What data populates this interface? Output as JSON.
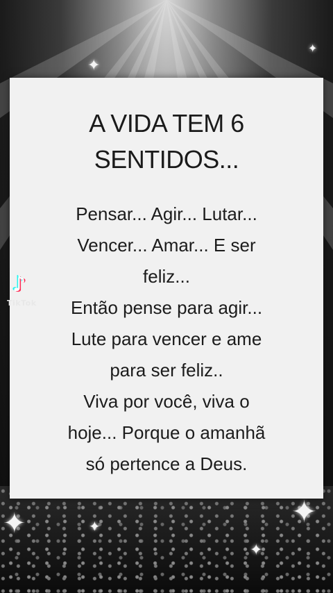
{
  "post": {
    "title_lines": [
      "A VIDA TEM 6",
      "SENTIDOS..."
    ],
    "body_lines": [
      "Pensar... Agir... Lutar...",
      "Vencer... Amar... E ser",
      "feliz...",
      "Então pense para agir...",
      "Lute para vencer e ame",
      "para ser feliz..",
      "Viva por você, viva o",
      "hoje... Porque o amanhã",
      "só pertence a Deus."
    ]
  },
  "watermark": {
    "brand": "TikTok",
    "icon": "tiktok-note-icon"
  },
  "colors": {
    "card_background": "#f1f1f1",
    "text": "#1a1a1a",
    "background": "#1b1b1b"
  }
}
